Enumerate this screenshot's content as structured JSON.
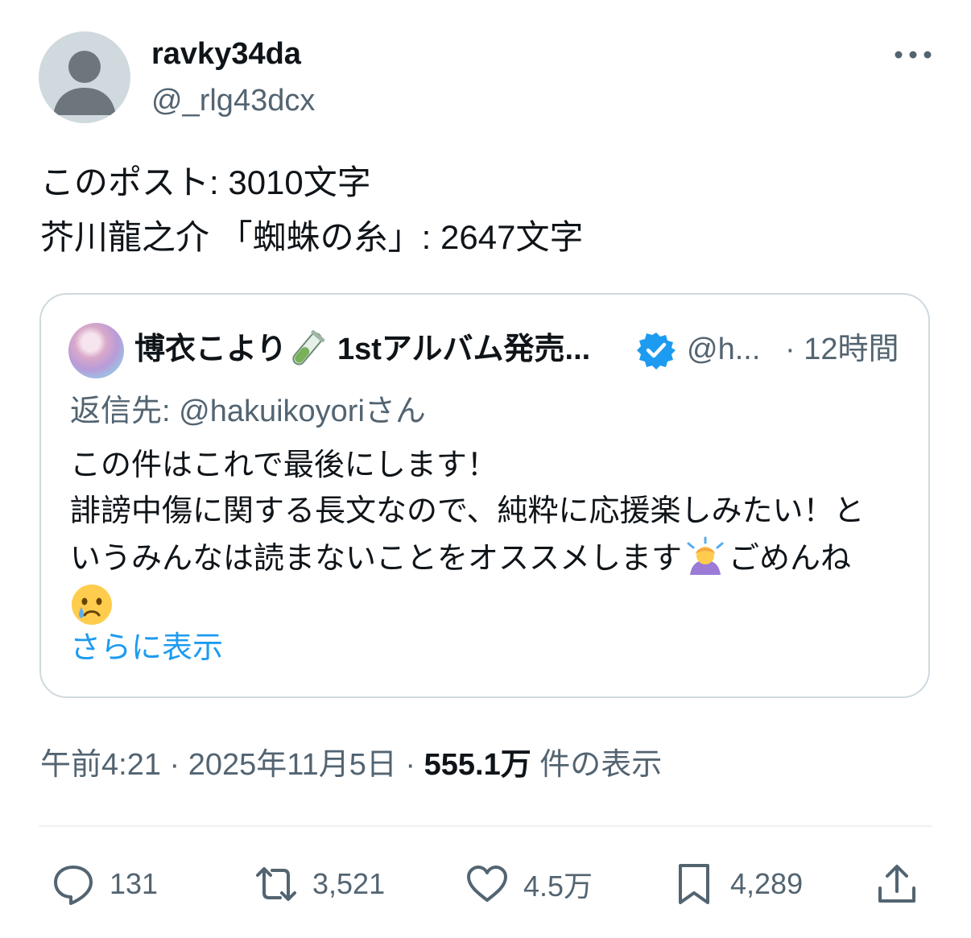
{
  "post": {
    "author_name": "ravky34da",
    "author_handle": "@_rlg43dcx",
    "lines": [
      "このポスト: 3010文字",
      "芥川龍之介 「蜘蛛の糸」: 2647文字"
    ]
  },
  "quote": {
    "name": "博衣こより",
    "name_rest": "1stアルバム発売...",
    "handle": "@h...",
    "time": "· 12時間",
    "reply_to": "返信先: @hakuikoyoriさん",
    "text_line1": "この件はこれで最後にします！",
    "text_line2": "誹謗中傷に関する長文なので、純粋に応援楽しみたい！と",
    "text_line3a": "いうみんなは読まないことをオススメします",
    "text_line3b": "ごめんね",
    "show_more": "さらに表示",
    "icons": [
      "test-tube-emoji",
      "verified-badge-icon",
      "person-bowing-emoji",
      "crying-face-emoji"
    ]
  },
  "meta": {
    "time_date": "午前4:21 · 2025年11月5日 · ",
    "views_count": "555.1万",
    "views_label": " 件の表示"
  },
  "actions": {
    "replies": "131",
    "reposts": "3,521",
    "likes": "4.5万",
    "bookmarks": "4,289"
  },
  "colors": {
    "accent": "#1d9bf0",
    "secondary_text": "#536471",
    "border": "#cfd9de"
  }
}
